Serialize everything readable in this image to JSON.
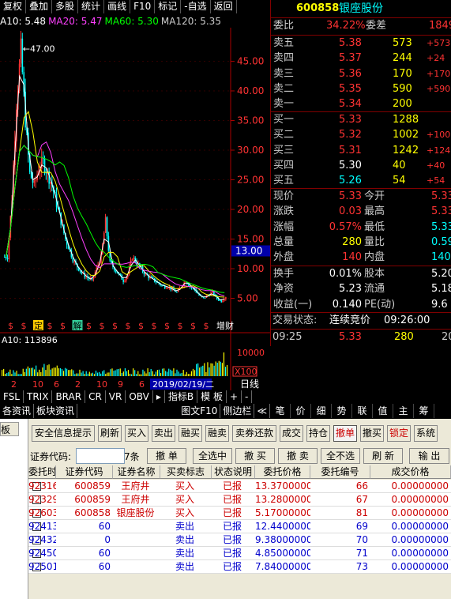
{
  "menu": [
    "复权",
    "叠加",
    "多股",
    "统计",
    "画线",
    "F10",
    "标记",
    "-自选",
    "返回"
  ],
  "ma_legend": [
    {
      "text": "A10: 5.48",
      "color": "#ffffff"
    },
    {
      "text": "MA20: 5.47",
      "color": "#ff40ff"
    },
    {
      "text": "MA60: 5.30",
      "color": "#00ff00"
    },
    {
      "text": "MA120: 5.35",
      "color": "#cccccc"
    }
  ],
  "chart": {
    "peak_label": "47.00",
    "price_axis": [
      "45.00",
      "40.00",
      "35.00",
      "30.00",
      "25.00",
      "20.00",
      "15.00",
      "10.00",
      "5.00"
    ],
    "current_price_marker": "13.00",
    "event_markers": [
      "$",
      "$",
      "定",
      "$",
      "$",
      "解",
      "$",
      "$",
      "$",
      "$",
      "$",
      "$",
      "$",
      "$",
      "$",
      "$",
      "增财"
    ],
    "volume_legend": "A10: 113896",
    "volume_axis": [
      "10000",
      "X100"
    ],
    "date_label": "2019/02/19/二",
    "period_label": "日线",
    "xaxis_ticks": [
      "2",
      "10",
      "6",
      "2",
      "10",
      "9",
      "6"
    ]
  },
  "chart_data": {
    "type": "candlestick",
    "ylim": [
      0,
      50
    ],
    "trend_close": [
      12,
      22,
      38,
      47,
      35,
      26,
      24,
      27,
      28,
      26,
      24,
      21,
      18,
      15,
      13,
      11,
      10,
      9,
      8.5,
      8,
      10,
      12,
      18,
      11,
      10,
      9,
      8,
      9,
      12,
      11,
      10,
      9,
      8.5,
      8,
      7.5,
      7,
      7,
      6.5,
      6,
      7,
      8,
      7,
      6.5,
      5.5,
      5,
      5.5,
      6,
      5,
      4.5,
      5.3
    ]
  },
  "indicator_tabs": [
    "FSL",
    "TRIX",
    "BRAR",
    "CR",
    "VR",
    "OBV",
    "▸",
    "指标B",
    "模 板",
    "+",
    "-"
  ],
  "info_tabs": [
    "各资讯",
    "板块资讯",
    "图文F10",
    "侧边栏",
    "≪"
  ],
  "right_tabs": [
    "笔",
    "价",
    "细",
    "势",
    "联",
    "值",
    "主",
    "筹"
  ],
  "quote": {
    "code": "600858",
    "name": "银座股份",
    "weibi_label": "委比",
    "weibi": "34.22%",
    "weicha_label": "委差",
    "weicha": "1849",
    "asks": [
      {
        "label": "卖五",
        "price": "5.38",
        "vol": "573",
        "chg": "+573"
      },
      {
        "label": "卖四",
        "price": "5.37",
        "vol": "244",
        "chg": "+24"
      },
      {
        "label": "卖三",
        "price": "5.36",
        "vol": "170",
        "chg": "+170"
      },
      {
        "label": "卖二",
        "price": "5.35",
        "vol": "590",
        "chg": "+590"
      },
      {
        "label": "卖一",
        "price": "5.34",
        "vol": "200",
        "chg": ""
      }
    ],
    "bids": [
      {
        "label": "买一",
        "price": "5.33",
        "vol": "1288",
        "chg": ""
      },
      {
        "label": "买二",
        "price": "5.32",
        "vol": "1002",
        "chg": "+1002"
      },
      {
        "label": "买三",
        "price": "5.31",
        "vol": "1242",
        "chg": "+1242"
      },
      {
        "label": "买四",
        "price": "5.30",
        "vol": "40",
        "chg": "+40"
      },
      {
        "label": "买五",
        "price": "5.26",
        "vol": "54",
        "chg": "+54"
      }
    ],
    "stats": [
      {
        "l1": "现价",
        "v1": "5.33",
        "l2": "今开",
        "v2": "5.33",
        "c1": "#ff3333",
        "c2": "#ff3333"
      },
      {
        "l1": "涨跌",
        "v1": "0.03",
        "l2": "最高",
        "v2": "5.33",
        "c1": "#ff3333",
        "c2": "#ff3333"
      },
      {
        "l1": "涨幅",
        "v1": "0.57%",
        "l2": "最低",
        "v2": "5.33",
        "c1": "#ff3333",
        "c2": "#00ffff"
      },
      {
        "l1": "总量",
        "v1": "280",
        "l2": "量比",
        "v2": "0.59",
        "c1": "#ffff00",
        "c2": "#00ffff"
      },
      {
        "l1": "外盘",
        "v1": "140",
        "l2": "内盘",
        "v2": "140",
        "c1": "#ff3333",
        "c2": "#00ffff"
      },
      {
        "l1": "换手",
        "v1": "0.01%",
        "l2": "股本",
        "v2": "5.20亿",
        "c1": "#ffffff",
        "c2": "#ffffff"
      },
      {
        "l1": "净资",
        "v1": "5.23",
        "l2": "流通",
        "v2": "5.18亿",
        "c1": "#ffffff",
        "c2": "#ffffff"
      },
      {
        "l1": "收益(一)",
        "v1": "0.140",
        "l2": "PE(动)",
        "v2": "9.6",
        "c1": "#ffffff",
        "c2": "#ffffff"
      }
    ],
    "status_label": "交易状态:",
    "status_value": "连续竞价",
    "status_time": "09:26:00",
    "tick": {
      "time": "09:25",
      "price": "5.33",
      "vol": "280",
      "extra": "20"
    }
  },
  "trade": {
    "left_tab": "板",
    "toolbar": [
      "安全信息提示",
      "刷新",
      "买入",
      "卖出",
      "融买",
      "融卖",
      "卖券还款",
      "成交",
      "持仓",
      "撤单",
      "撤买",
      "锁定",
      "系统"
    ],
    "code_label": "证券代码:",
    "code_value": "",
    "count_label": "7条",
    "action_buttons": [
      "撤 单",
      "全选中",
      "撤 买",
      "撤 卖",
      "全不选",
      "刷 新",
      "输 出"
    ],
    "columns": [
      "委托时间",
      "证券代码",
      "证券名称",
      "买卖标志",
      "状态说明",
      "委托价格",
      "委托编号",
      "成交价格"
    ],
    "rows": [
      {
        "time": "92316",
        "code": "600859",
        "name": "王府井",
        "side": "买入",
        "status": "已报",
        "price": "13.37000000",
        "id": "66",
        "deal": "0.00000000",
        "color": "#cc0000"
      },
      {
        "time": "92329",
        "code": "600859",
        "name": "王府井",
        "side": "买入",
        "status": "已报",
        "price": "13.28000000",
        "id": "67",
        "deal": "0.00000000",
        "color": "#cc0000"
      },
      {
        "time": "92603",
        "code": "600858",
        "name": "银座股份",
        "side": "买入",
        "status": "已报",
        "price": "5.17000000",
        "id": "81",
        "deal": "0.00000000",
        "color": "#cc0000"
      },
      {
        "time": "92413",
        "code": "60",
        "name": "",
        "side": "卖出",
        "status": "已报",
        "price": "12.44000000",
        "id": "69",
        "deal": "0.00000000",
        "color": "#0000cc"
      },
      {
        "time": "92432",
        "code": "0",
        "name": "",
        "side": "卖出",
        "status": "已报",
        "price": "9.38000000",
        "id": "70",
        "deal": "0.00000000",
        "color": "#0000cc"
      },
      {
        "time": "92450",
        "code": "60",
        "name": "",
        "side": "卖出",
        "status": "已报",
        "price": "4.85000000",
        "id": "71",
        "deal": "0.00000000",
        "color": "#0000cc"
      },
      {
        "time": "92501",
        "code": "60",
        "name": "",
        "side": "卖出",
        "status": "已报",
        "price": "7.84000000",
        "id": "73",
        "deal": "0.00000000",
        "color": "#0000cc"
      }
    ]
  }
}
